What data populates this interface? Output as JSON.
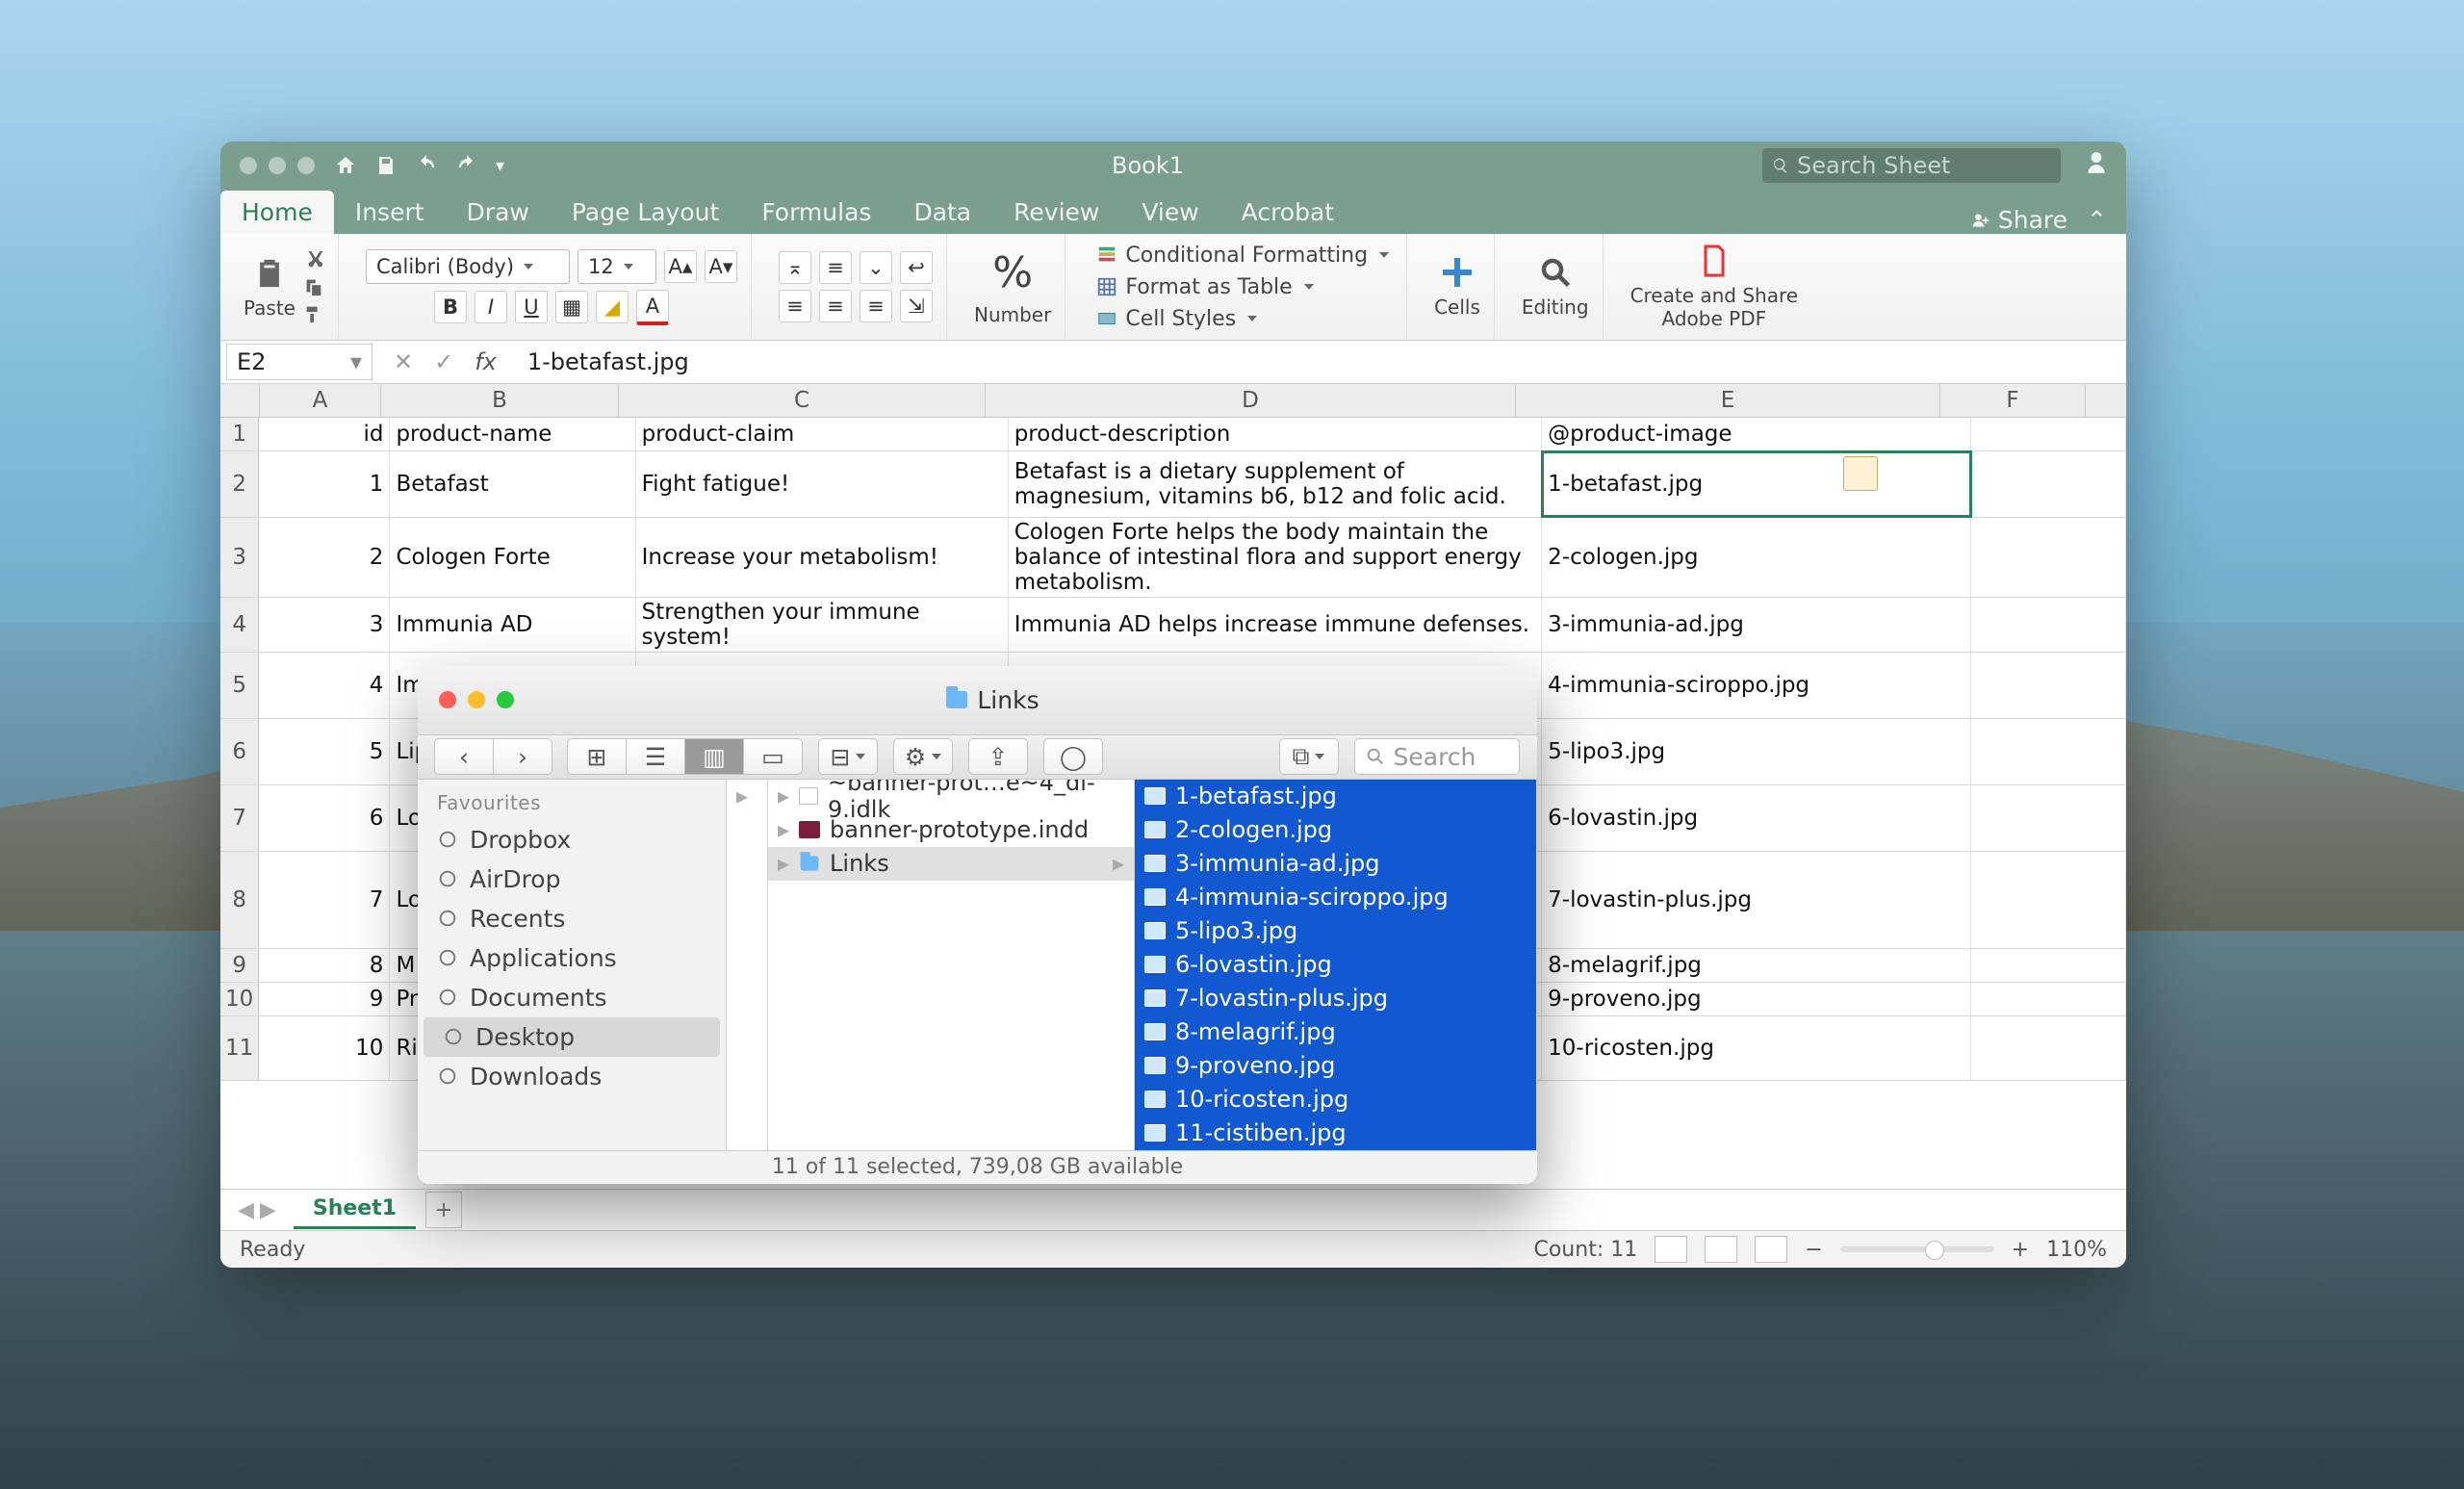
{
  "window": {
    "title": "Book1",
    "search_placeholder": "Search Sheet"
  },
  "tabs": {
    "items": [
      "Home",
      "Insert",
      "Draw",
      "Page Layout",
      "Formulas",
      "Data",
      "Review",
      "View",
      "Acrobat"
    ],
    "share": "Share"
  },
  "ribbon": {
    "paste": "Paste",
    "font_name": "Calibri (Body)",
    "font_size": "12",
    "number_label": "Number",
    "percent": "%",
    "cond_fmt": "Conditional Formatting",
    "fmt_table": "Format as Table",
    "cell_styles": "Cell Styles",
    "cells": "Cells",
    "editing": "Editing",
    "pdf_l1": "Create and Share",
    "pdf_l2": "Adobe PDF"
  },
  "formula_bar": {
    "cell_ref": "E2",
    "value": "1-betafast.jpg",
    "fx": "fx"
  },
  "columns": [
    "A",
    "B",
    "C",
    "D",
    "E",
    "F"
  ],
  "headers": {
    "A": "id",
    "B": "product-name",
    "C": "product-claim",
    "D": "product-description",
    "E": "@product-image"
  },
  "rows": [
    {
      "n": "1",
      "A": "id",
      "B": "product-name",
      "C": "product-claim",
      "D": "product-description",
      "E": "@product-image"
    },
    {
      "n": "2",
      "A": "1",
      "B": "Betafast",
      "C": "Fight fatigue!",
      "D": "Betafast is a dietary supplement of magnesium, vitamins b6, b12 and folic acid.",
      "E": "1-betafast.jpg",
      "sel": true,
      "h": 68
    },
    {
      "n": "3",
      "A": "2",
      "B": "Cologen Forte",
      "C": "Increase your metabolism!",
      "D": "Cologen Forte helps the body maintain the balance of intestinal flora and support energy metabolism.",
      "E": "2-cologen.jpg",
      "h": 68
    },
    {
      "n": "4",
      "A": "3",
      "B": "Immunia AD",
      "C": "Strengthen your immune system!",
      "D": "Immunia AD helps increase immune defenses.",
      "E": "3-immunia-ad.jpg"
    },
    {
      "n": "5",
      "A": "4",
      "B": "Im",
      "C": "",
      "D": "",
      "E": "4-immunia-sciroppo.jpg",
      "h": 68
    },
    {
      "n": "6",
      "A": "5",
      "B": "Lip",
      "C": "",
      "D": "",
      "E": "5-lipo3.jpg",
      "h": 68
    },
    {
      "n": "7",
      "A": "6",
      "B": "Lo",
      "C": "",
      "D": "",
      "E": "6-lovastin.jpg",
      "h": 68
    },
    {
      "n": "8",
      "A": "7",
      "B": "Lo",
      "C": "",
      "D": "",
      "E": "7-lovastin-plus.jpg",
      "h": 100
    },
    {
      "n": "9",
      "A": "8",
      "B": "M",
      "C": "",
      "D": "",
      "E": "8-melagrif.jpg"
    },
    {
      "n": "10",
      "A": "9",
      "B": "Pr",
      "C": "",
      "D": "",
      "E": "9-proveno.jpg"
    },
    {
      "n": "11",
      "A": "10",
      "B": "Ri",
      "C": "",
      "D": "",
      "E": "10-ricosten.jpg",
      "h": 66
    }
  ],
  "sheet_tab": "Sheet1",
  "status": {
    "left": "Ready",
    "count": "Count: 11",
    "zoom": "110%"
  },
  "finder": {
    "title": "Links",
    "search_placeholder": "Search",
    "sidebar_header": "Favourites",
    "sidebar": [
      "Dropbox",
      "AirDrop",
      "Recents",
      "Applications",
      "Documents",
      "Desktop",
      "Downloads"
    ],
    "sidebar_selected": "Desktop",
    "col2": [
      {
        "name": "~banner-prot…e~4_dl-9.idlk",
        "type": "file"
      },
      {
        "name": "banner-prototype.indd",
        "type": "indd"
      },
      {
        "name": "Links",
        "type": "folder",
        "sel": true
      }
    ],
    "col3": [
      "1-betafast.jpg",
      "2-cologen.jpg",
      "3-immunia-ad.jpg",
      "4-immunia-sciroppo.jpg",
      "5-lipo3.jpg",
      "6-lovastin.jpg",
      "7-lovastin-plus.jpg",
      "8-melagrif.jpg",
      "9-proveno.jpg",
      "10-ricosten.jpg",
      "11-cistiben.jpg"
    ],
    "status": "11 of 11 selected, 739,08 GB available"
  }
}
